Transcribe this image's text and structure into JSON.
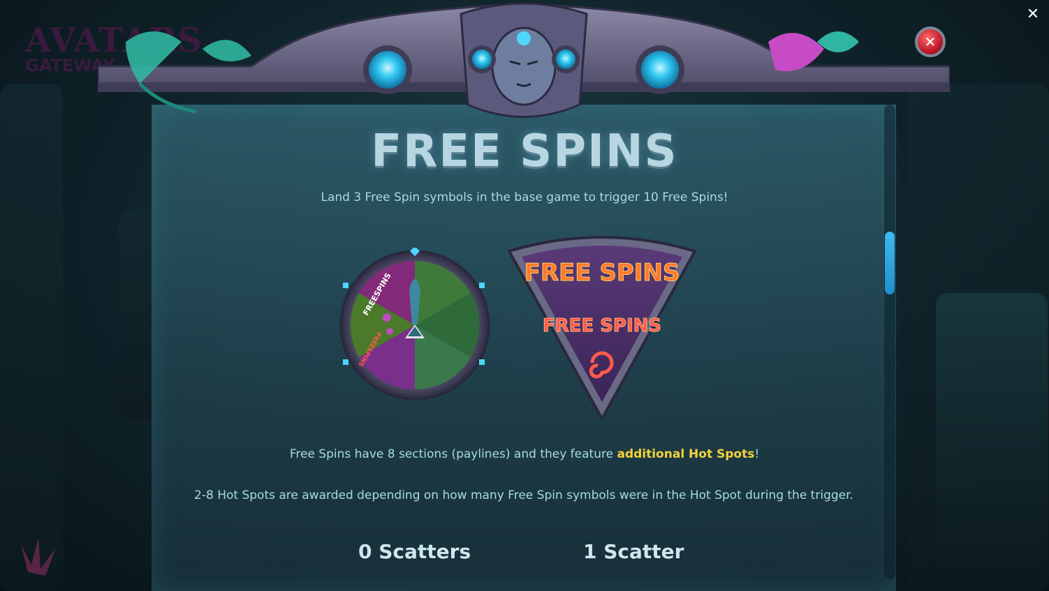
{
  "logo": {
    "line1": "AVATARS",
    "line2": "GATEWAY"
  },
  "header": {
    "title": "FREE SPINS",
    "close_icon": "close-icon",
    "close_round_icon": "close-circle-icon",
    "close_x": "✕",
    "close_round_x": "✕"
  },
  "paragraphs": {
    "intro": "Land 3 Free Spin symbols in the base game to trigger 10 Free Spins!",
    "sections_prefix": "Free Spins have 8 sections (paylines) and they feature ",
    "sections_highlight": "additional Hot Spots",
    "sections_suffix": "!",
    "hotspots": "2-8 Hot Spots are awarded depending on how many Free Spin symbols were in the Hot Spot during the trigger."
  },
  "symbols": {
    "wheel_label_a": "FREESPINS",
    "wheel_label_b": "FREESPINS",
    "tri_label_top": "FREE SPINS",
    "tri_label_mid": "FREE SPINS"
  },
  "scatter_labels": {
    "left": "0 Scatters",
    "right": "1 Scatter"
  },
  "colors": {
    "accent": "#3fb9ee",
    "highlight": "#f4d23a",
    "text": "#a6dbe2",
    "close_red": "#c01a2a"
  },
  "scroll": {
    "position": 0.26
  }
}
